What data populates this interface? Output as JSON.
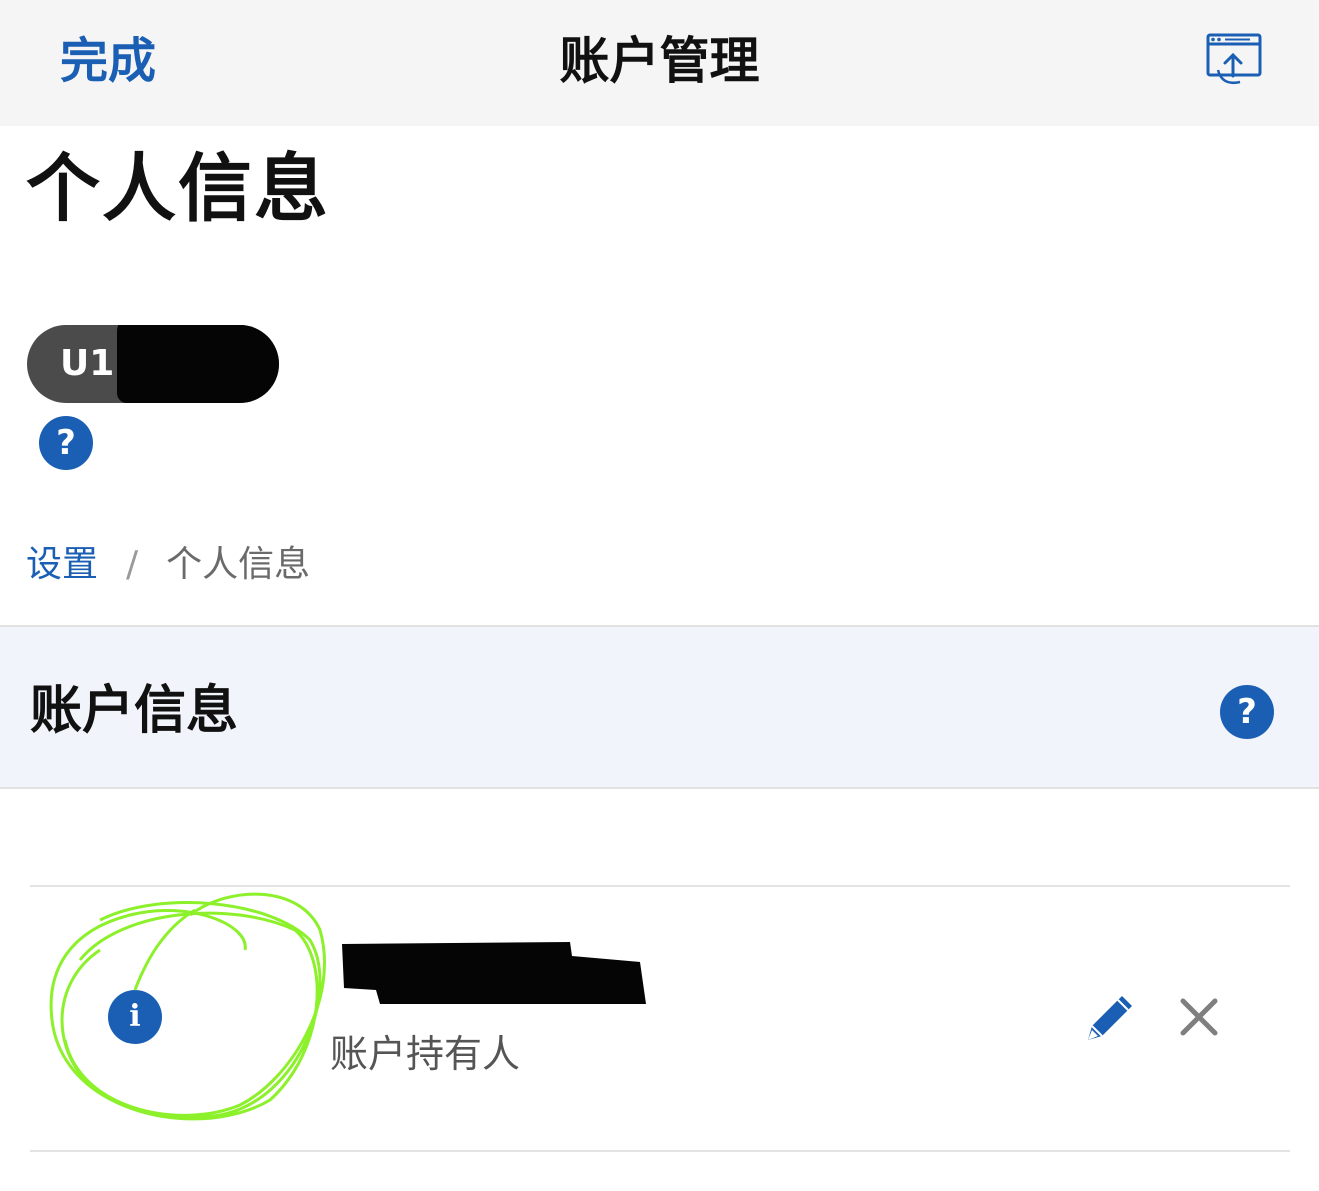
{
  "nav": {
    "done_label": "完成",
    "title": "账户管理",
    "share_icon": "share-window-icon"
  },
  "page": {
    "title": "个人信息"
  },
  "account_pill": {
    "label": "U1"
  },
  "breadcrumb": {
    "parent": "设置",
    "separator": "/",
    "current": "个人信息"
  },
  "section": {
    "title": "账户信息"
  },
  "holder_row": {
    "subtitle": "账户持有人",
    "info_icon_glyph": "i"
  },
  "icons": {
    "help_glyph": "?",
    "edit": "pencil-icon",
    "remove": "close-icon",
    "info": "info-icon"
  },
  "colors": {
    "accent": "#1a5fb4",
    "section_bg": "#f1f5fb",
    "topbar_bg": "#f5f5f5",
    "annotation": "#8cf02a"
  }
}
